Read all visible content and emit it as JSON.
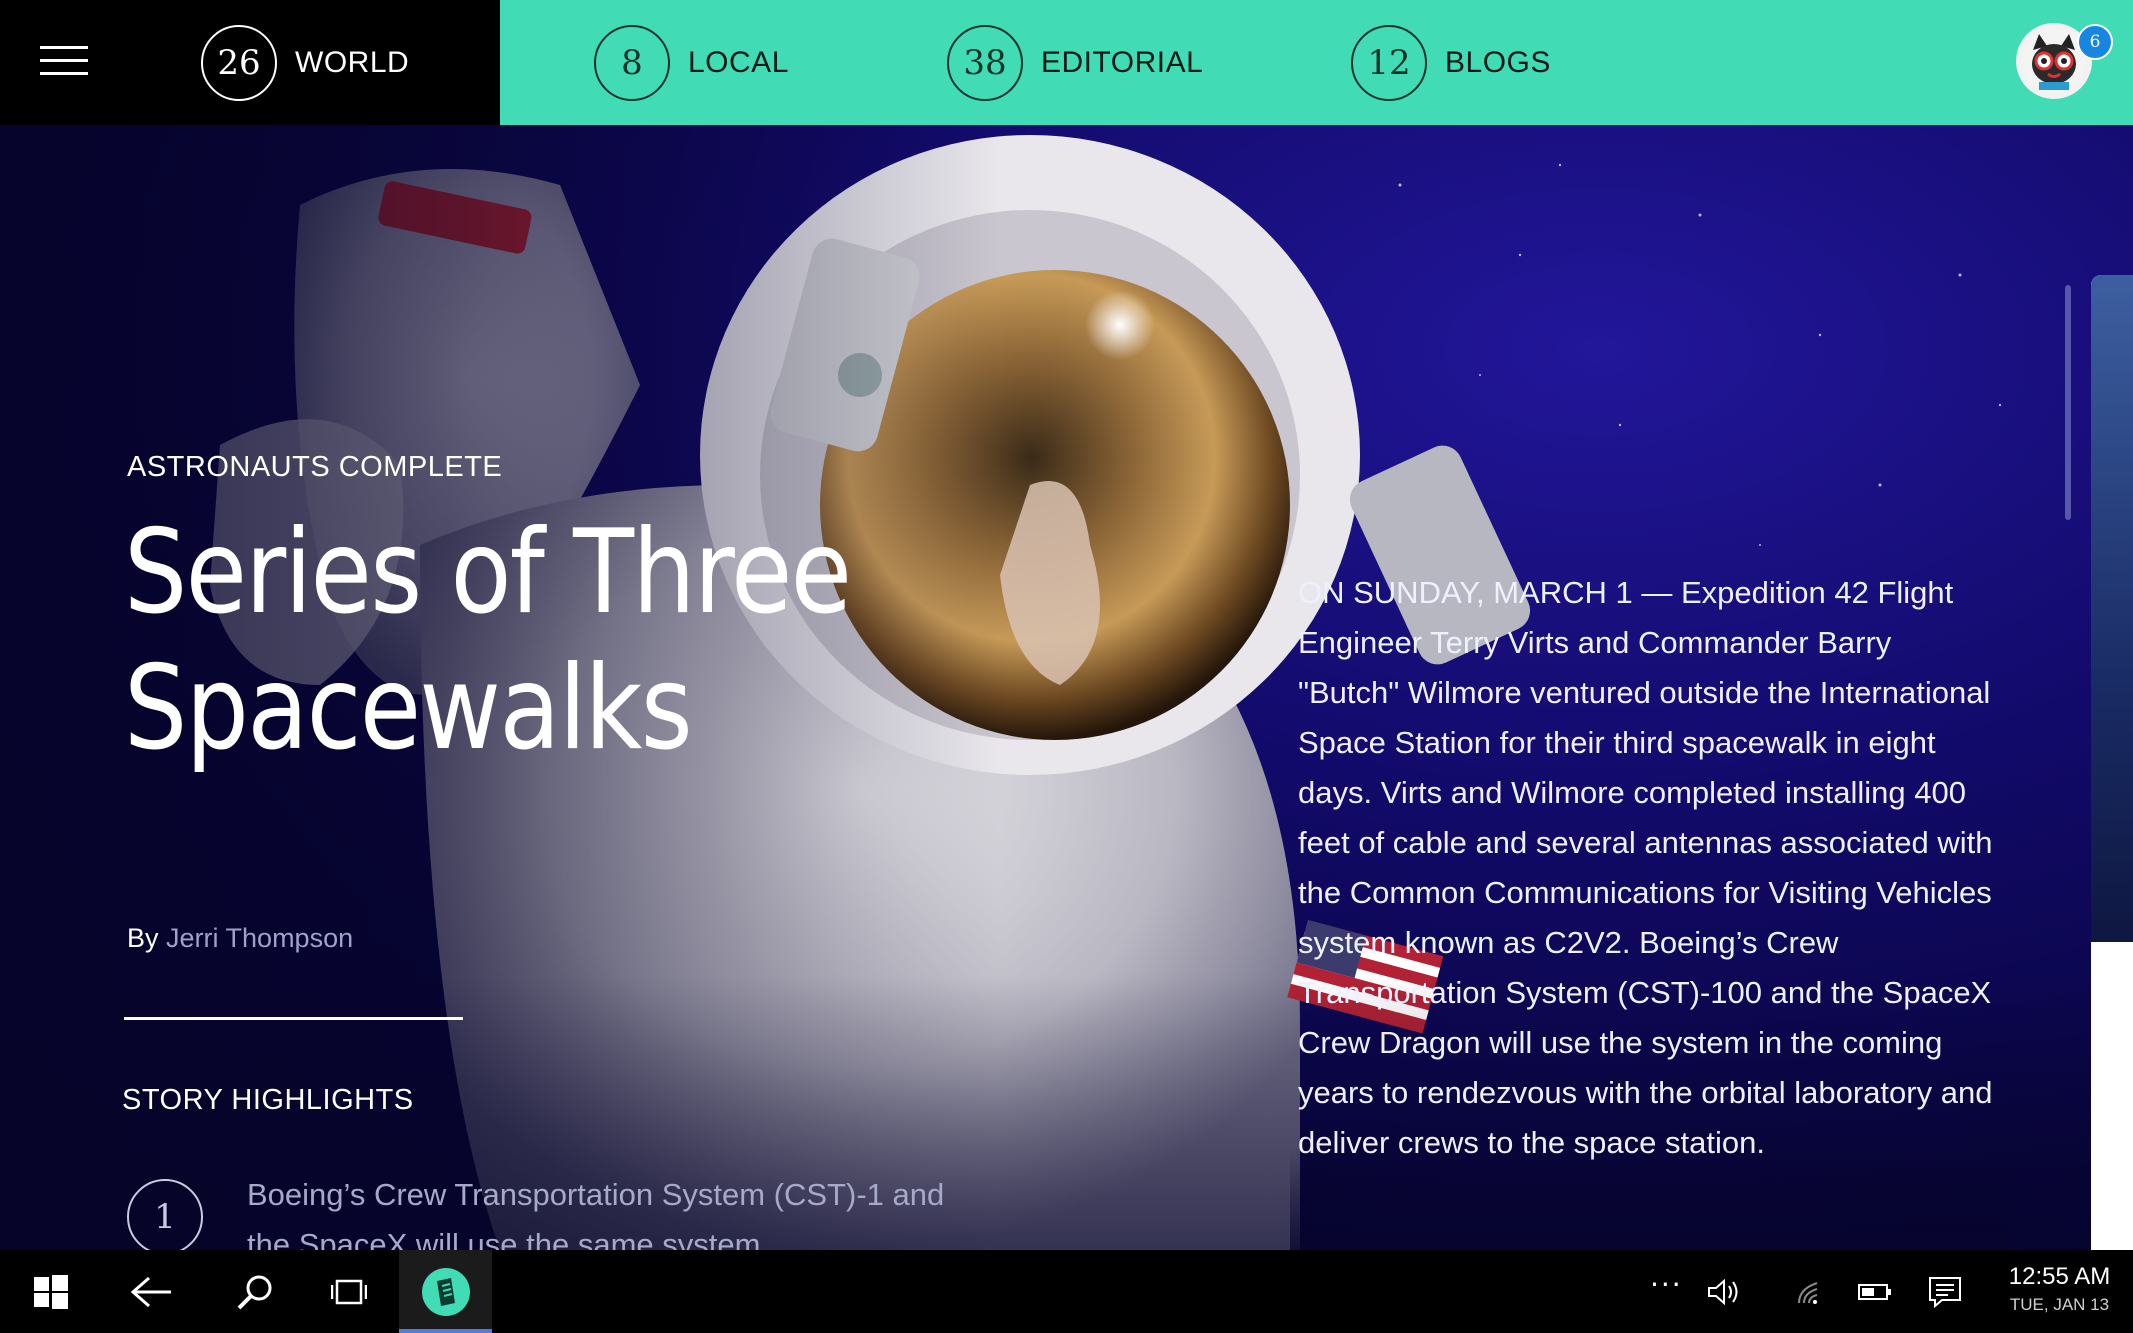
{
  "nav": {
    "menu_icon": "hamburger-menu-icon",
    "tabs": [
      {
        "count": "26",
        "label": "WORLD",
        "active": true
      },
      {
        "count": "8",
        "label": "LOCAL",
        "active": false
      },
      {
        "count": "38",
        "label": "EDITORIAL",
        "active": false
      },
      {
        "count": "12",
        "label": "BLOGS",
        "active": false
      }
    ],
    "notifications": "6",
    "colors": {
      "accent": "#41dcb5",
      "active_tab_bg": "#000000",
      "badge": "#1786e0"
    }
  },
  "article": {
    "kicker": "ASTRONAUTS COMPLETE",
    "headline_line1": "Series of Three",
    "headline_line2": "Spacewalks",
    "by": "By",
    "author": "Jerri Thompson",
    "highlights_title": "STORY HIGHLIGHTS",
    "highlights": [
      {
        "number": "1",
        "text": "Boeing’s Crew Transportation System (CST)-1 and the SpaceX will use the same system"
      }
    ],
    "body": "ON SUNDAY, MARCH 1 — Expedition 42 Flight Engineer Terry Virts and Commander Barry \"Butch\" Wilmore ventured outside the International Space Station for their third spacewalk in eight days. Virts and Wilmore completed installing 400 feet of cable and several antennas associated with the Common Communications for Visiting Vehicles system known as C2V2. Boeing’s Crew Transportation System (CST)-100 and the SpaceX Crew Dragon will use the system in the coming years to rendezvous with the orbital laboratory and deliver crews to the space station."
  },
  "taskbar": {
    "icons": [
      "windows-start-icon",
      "back-arrow-icon",
      "search-icon",
      "task-view-icon",
      "news-app-icon"
    ],
    "tray_icons": [
      "more-dots-icon",
      "volume-icon",
      "wifi-icon",
      "battery-icon",
      "action-center-icon"
    ],
    "tray_more": "···",
    "time": "12:55 AM",
    "date": "TUE, JAN 13"
  }
}
